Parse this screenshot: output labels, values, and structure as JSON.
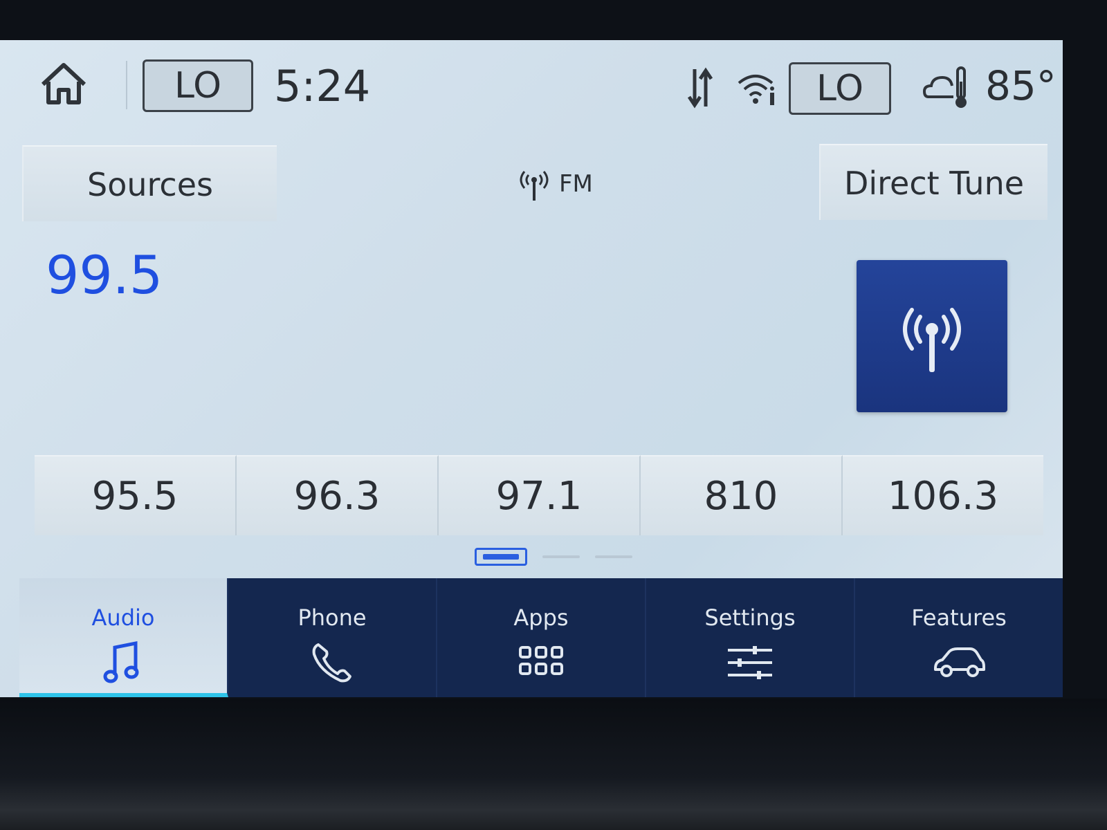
{
  "status": {
    "clock": "5:24",
    "climate_left": "LO",
    "climate_right": "LO",
    "temperature": "85°"
  },
  "audio": {
    "sources_label": "Sources",
    "direct_tune_label": "Direct Tune",
    "band": "FM",
    "current_frequency": "99.5"
  },
  "presets": [
    "95.5",
    "96.3",
    "97.1",
    "810",
    "106.3"
  ],
  "pager": {
    "pages": 3,
    "active": 1
  },
  "nav": {
    "audio": "Audio",
    "phone": "Phone",
    "apps": "Apps",
    "settings": "Settings",
    "features": "Features"
  },
  "colors": {
    "accent_blue": "#1f4fe0",
    "nav_bg": "#14274f",
    "tile_bg": "#1a347e",
    "active_underline": "#2ec3e8"
  }
}
